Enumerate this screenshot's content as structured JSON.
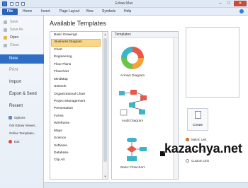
{
  "window": {
    "title": "Edraw Max"
  },
  "window_controls": {
    "minimize": "–",
    "maximize": "□",
    "close": "✕"
  },
  "ribbon": {
    "file_tab": "File",
    "tabs": [
      "Home",
      "Insert",
      "Page Layout",
      "View",
      "Symbols",
      "Help"
    ]
  },
  "backstage": {
    "small_items": [
      "Save",
      "Save As",
      "Open",
      "Close"
    ],
    "new_label": "New",
    "print_label": "Print",
    "import_label": "Import",
    "export_label": "Export & Send",
    "recent_label": "Recent",
    "tiny_items": [
      "Options",
      "Get Edraw Viewer...",
      "Online Templates...",
      "Exit"
    ]
  },
  "main": {
    "title": "Available Templates",
    "categories": [
      "Basic Drawings",
      "Business Diagram",
      "Chart",
      "Engineering",
      "Floor Plans",
      "Flowchart",
      "MindMap",
      "Network",
      "Organizational Chart",
      "Project Management",
      "Presentation",
      "Forms",
      "Wireframe",
      "Maps",
      "Science",
      "Software",
      "Database",
      "Clip Art"
    ],
    "selected_category": "Business Diagram",
    "templates_header": "Templates",
    "templates": [
      {
        "label": "Arrows Diagram",
        "icon": "arrows-cycle-icon"
      },
      {
        "label": "Audit Diagram",
        "icon": "audit-flow-icon"
      },
      {
        "label": "Basic Flowchart",
        "icon": "flowchart-icon"
      }
    ]
  },
  "right": {
    "create_label": "Create",
    "units": [
      {
        "label": "Metric Unit",
        "selected": true
      },
      {
        "label": "U.S. Unit",
        "selected": false
      },
      {
        "label": "Custom Unit",
        "selected": false
      }
    ]
  },
  "watermark": "kazachya.net",
  "colors": {
    "accent": "#2f6ec5",
    "selection": "#fbd785",
    "arrow_red": "#e8574a",
    "arrow_orange": "#f5a03a",
    "arrow_green": "#6cc24a",
    "arrow_teal": "#3cb4c9"
  }
}
